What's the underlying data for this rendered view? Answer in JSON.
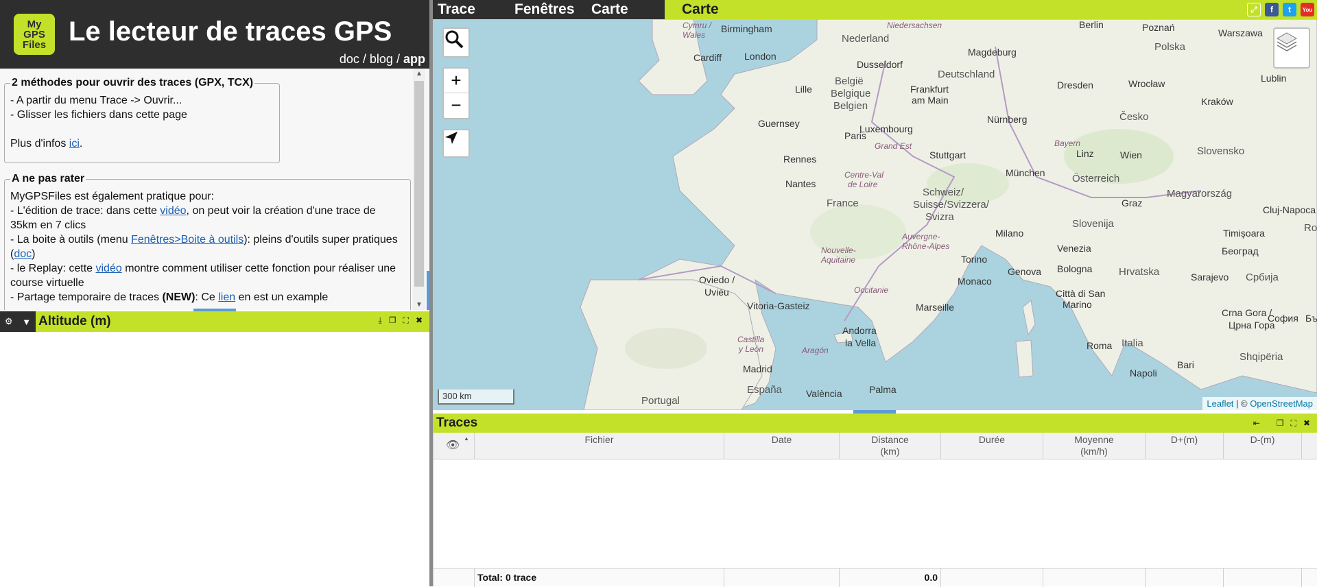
{
  "app": {
    "logo_lines": [
      "My",
      "GPS",
      "Files"
    ],
    "title": "Le lecteur de traces GPS",
    "links": {
      "doc": "doc",
      "sep1": "/",
      "blog": "blog",
      "sep2": "/",
      "app": "app"
    }
  },
  "info": {
    "box1": {
      "legend": "2 méthodes pour ouvrir des traces (GPX, TCX)",
      "line1": "- A partir du menu Trace -> Ouvrir...",
      "line2": "- Glisser les fichiers dans cette page",
      "more_prefix": "Plus d'infos ",
      "more_link": "ici",
      "more_suffix": "."
    },
    "box2": {
      "legend": "A ne pas rater",
      "intro": "MyGPSFiles est également pratique pour:",
      "edit_prefix": "- L'édition de trace: dans cette ",
      "edit_link": "vidéo",
      "edit_suffix": ", on peut voir la création d'une trace de 35km en 7 clics",
      "tools_prefix": "- La boite à outils (menu ",
      "tools_link": "Fenêtres>Boite à outils",
      "tools_mid": "): pleins d'outils super pratiques (",
      "tools_doc": "doc",
      "tools_suffix": ")",
      "replay_prefix": "- le Replay: cette ",
      "replay_link": "vidéo",
      "replay_suffix": " montre comment utiliser cette fonction pour réaliser une course virtuelle",
      "share_prefix": "- Partage temporaire de traces ",
      "share_new": "(NEW)",
      "share_mid": ": Ce ",
      "share_link": "lien",
      "share_suffix": " en est un example"
    }
  },
  "altitude": {
    "title": "Altitude (m)"
  },
  "menu": {
    "trace": "Trace",
    "fenetres": "Fenêtres",
    "carte": "Carte",
    "active_tab": "Carte"
  },
  "social": {
    "facebook": "f",
    "twitter": "t",
    "youtube": "You",
    "colors": {
      "facebook": "#3b5998",
      "twitter": "#1da1f2",
      "youtube": "#e52d27"
    }
  },
  "map": {
    "scale": "300 km",
    "attribution_leaflet": "Leaflet",
    "attribution_sep": " | © ",
    "attribution_osm": "OpenStreetMap",
    "labels": {
      "birmingham": "Birmingham",
      "cymru": "Cymru /",
      "wales": "Wales",
      "cardiff": "Cardiff",
      "london": "London",
      "niedersachsen": "Niedersachsen",
      "nederland": "Nederland",
      "berlin": "Berlin",
      "poznan": "Poznań",
      "warszawa": "Warszawa",
      "polska": "Polska",
      "dusseldorf": "Dusseldorf",
      "magdeburg": "Magdeburg",
      "deutschland": "Deutschland",
      "belgie": "België",
      "belgique": "Belgique",
      "belgien": "Belgien",
      "lille": "Lille",
      "frankfurt": "Frankfurt",
      "am_main": "am Main",
      "dresden": "Dresden",
      "wroclaw": "Wrocław",
      "lublin": "Lublin",
      "krakow": "Kraków",
      "guernsey": "Guernsey",
      "luxembourg": "Luxembourg",
      "paris": "Paris",
      "nurnberg": "Nürnberg",
      "cesko": "Česko",
      "grand_est": "Grand Est",
      "rennes": "Rennes",
      "stuttgart": "Stuttgart",
      "bayern": "Bayern",
      "linz": "Linz",
      "wien": "Wien",
      "slovensko": "Slovensko",
      "munchen": "München",
      "nantes": "Nantes",
      "centre_val": "Centre-Val",
      "de_loire": "de Loire",
      "osterreich": "Österreich",
      "schweiz": "Schweiz/",
      "suisse": "Suisse/Svizzera/",
      "svizra": "Svizra",
      "france": "France",
      "magyarorszag": "Magyarország",
      "graz": "Graz",
      "cluj": "Cluj-Napoca",
      "slovenija": "Slovenija",
      "romania": "Româ",
      "milano": "Milano",
      "venezia": "Venezia",
      "timisoara": "Timișoara",
      "auvergne": "Auvergne-",
      "rhone_alpes": "Rhône-Alpes",
      "nouvelle": "Nouvelle-",
      "aquitaine": "Aquitaine",
      "torino": "Torino",
      "genova": "Genova",
      "bologna": "Bologna",
      "hrvatska": "Hrvatska",
      "beograd": "Београд",
      "oviedo": "Oviedo /",
      "uvieu": "Uviéu",
      "monaco": "Monaco",
      "sarajevo": "Sarajevo",
      "srbija": "Србија",
      "occitanie": "Occitanie",
      "citta": "Città di San",
      "marino": "Marino",
      "vitoria": "Vitoria-Gasteiz",
      "marseille": "Marseille",
      "crna": "Crna Gora /",
      "crna2": "Црна Гора",
      "sofia": "София",
      "b": "Бъ",
      "andorra": "Andorra",
      "la_vella": "la Vella",
      "castilla": "Castilla",
      "y_leon": "y León",
      "aragon": "Aragón",
      "roma": "Roma",
      "italia": "Italia",
      "shqiperia": "Shqipëria",
      "madrid": "Madrid",
      "bari": "Bari",
      "napoli": "Napoli",
      "espana": "España",
      "valencia": "València",
      "palma": "Palma",
      "portugal": "Portugal"
    }
  },
  "traces": {
    "title": "Traces",
    "columns": [
      {
        "l1": "Fichier",
        "l2": ""
      },
      {
        "l1": "Date",
        "l2": ""
      },
      {
        "l1": "Distance",
        "l2": "(km)"
      },
      {
        "l1": "Durée",
        "l2": ""
      },
      {
        "l1": "Moyenne",
        "l2": "(km/h)"
      },
      {
        "l1": "D+(m)",
        "l2": ""
      },
      {
        "l1": "D-(m)",
        "l2": ""
      }
    ],
    "total_label": "Total: 0 trace",
    "total_distance": "0.0"
  }
}
